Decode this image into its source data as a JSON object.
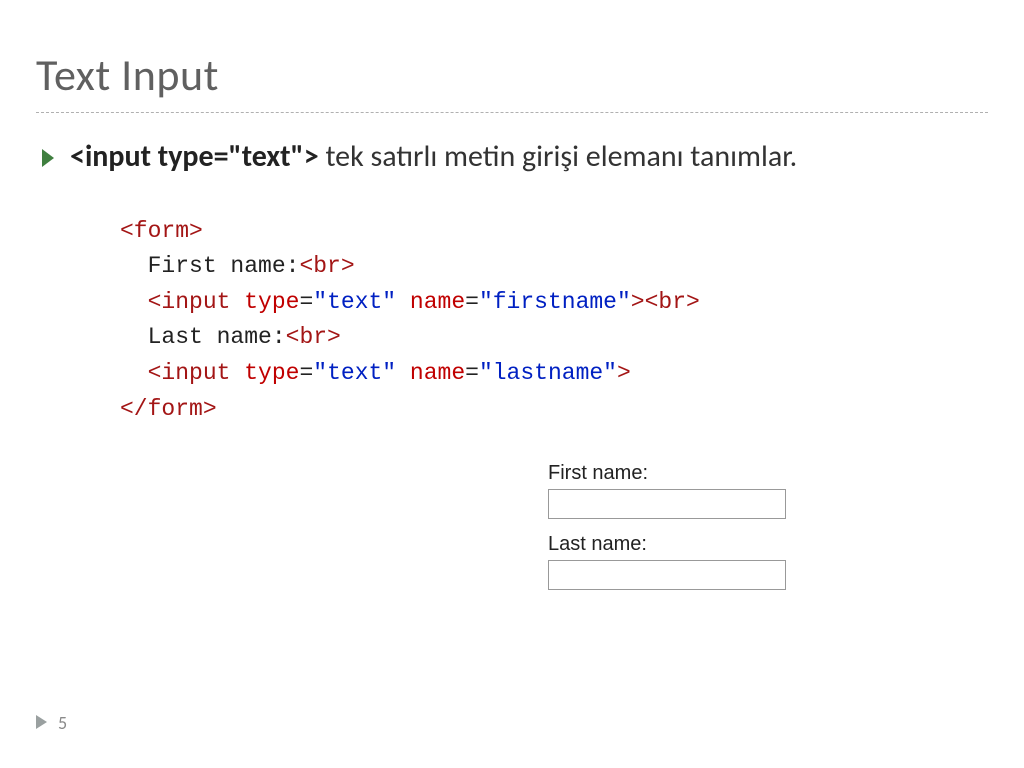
{
  "title": "Text Input",
  "bullet": {
    "code": "<input type=\"text\">",
    "rest": " tek satırlı metin girişi elemanı tanımlar."
  },
  "code": {
    "l1_open": "<form>",
    "l2_label": "First name:",
    "l2_br": "<br>",
    "l3_open": "<input",
    "l3_attr1_name": "type",
    "l3_attr1_eq": "=",
    "l3_attr1_val": "\"text\"",
    "l3_attr2_name": "name",
    "l3_attr2_eq": "=",
    "l3_attr2_val": "\"firstname\"",
    "l3_close": ">",
    "l3_br": "<br>",
    "l4_label": "Last name:",
    "l4_br": "<br>",
    "l5_open": "<input",
    "l5_attr1_name": "type",
    "l5_attr1_eq": "=",
    "l5_attr1_val": "\"text\"",
    "l5_attr2_name": "name",
    "l5_attr2_eq": "=",
    "l5_attr2_val": "\"lastname\"",
    "l5_close": ">",
    "l6_close": "</form>"
  },
  "form": {
    "first_label": "First name:",
    "last_label": "Last name:"
  },
  "page_number": "5"
}
